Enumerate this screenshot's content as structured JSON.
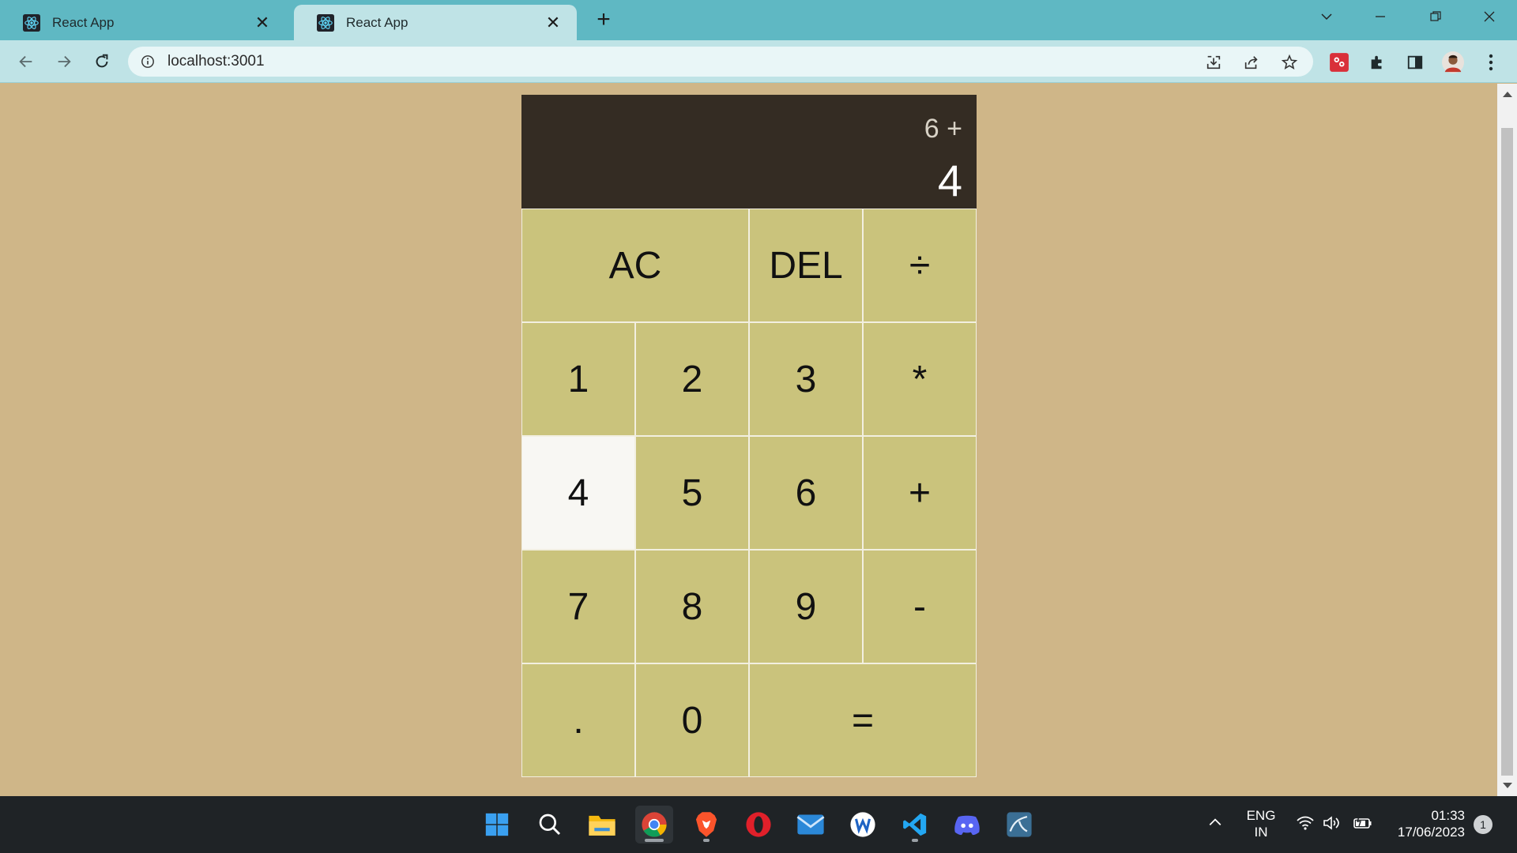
{
  "browser": {
    "tabs": [
      {
        "title": "React App",
        "active": false
      },
      {
        "title": "React App",
        "active": true
      }
    ],
    "new_tab_label": "+",
    "address": "localhost:3001",
    "colors": {
      "tab_strip": "#5fb8c3",
      "toolbar": "#bfe3e6"
    }
  },
  "calculator": {
    "previous_operand": "6 +",
    "current_operand": "4",
    "keys": {
      "ac": "AC",
      "del": "DEL",
      "divide": "÷",
      "one": "1",
      "two": "2",
      "three": "3",
      "multiply": "*",
      "four": "4",
      "five": "5",
      "six": "6",
      "add": "+",
      "seven": "7",
      "eight": "8",
      "nine": "9",
      "subtract": "-",
      "dot": ".",
      "zero": "0",
      "equals": "="
    },
    "pressed_key": "4",
    "colors": {
      "display_bg": "#342c23",
      "key_bg": "#cac37c",
      "page_bg": "#cfb688"
    }
  },
  "taskbar": {
    "apps": [
      "windows-start",
      "search",
      "file-explorer",
      "chrome",
      "brave",
      "opera",
      "mail",
      "wordpad",
      "vscode",
      "discord",
      "mysql-workbench"
    ],
    "language_line1": "ENG",
    "language_line2": "IN",
    "time": "01:33",
    "date": "17/06/2023",
    "notification_count": "1"
  }
}
